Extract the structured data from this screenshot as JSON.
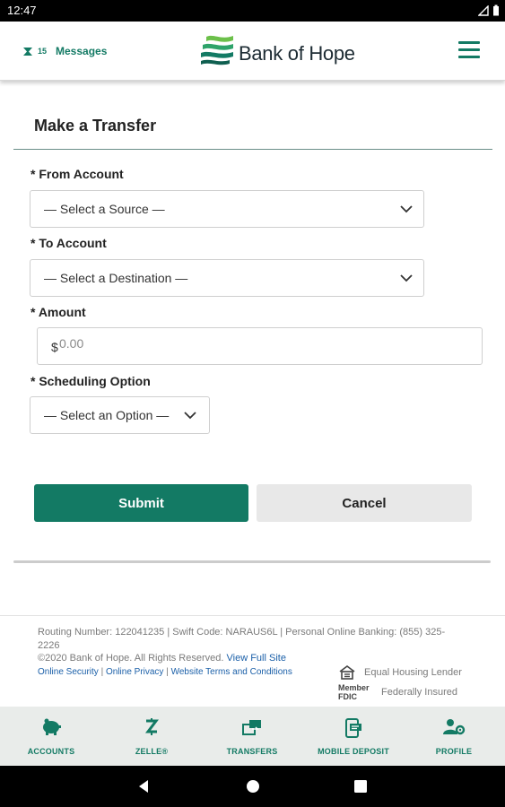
{
  "status_bar": {
    "time": "12:47"
  },
  "header": {
    "messages_count": "15",
    "messages_label": "Messages",
    "brand_name": "Bank of Hope",
    "colors": {
      "brand": "#137a64",
      "text": "#1d2b33"
    }
  },
  "form": {
    "title": "Make a Transfer",
    "from_label": "* From Account",
    "from_value": "— Select a Source —",
    "to_label": "* To Account",
    "to_value": "— Select a Destination —",
    "amount_label": "* Amount",
    "amount_currency": "$",
    "amount_placeholder": "0.00",
    "schedule_label": "* Scheduling Option",
    "schedule_value": "— Select an Option —",
    "submit_label": "Submit",
    "cancel_label": "Cancel"
  },
  "footer": {
    "info": "Routing Number: 122041235 | Swift Code: NARAUS6L | Personal Online Banking: (855) 325-2226",
    "copyright": "©2020 Bank of Hope. All Rights Reserved.",
    "view_full_site": "View Full Site",
    "links": [
      "Online Security",
      "Online Privacy",
      "Website Terms and Conditions"
    ],
    "equal_housing": "Equal Housing Lender",
    "fdic_badge": "Member FDIC",
    "federally_insured": "Federally Insured"
  },
  "tabs": [
    {
      "label": "ACCOUNTS",
      "icon": "piggy-bank-icon"
    },
    {
      "label": "ZELLE®",
      "icon": "zelle-icon"
    },
    {
      "label": "TRANSFERS",
      "icon": "transfer-icon"
    },
    {
      "label": "MOBILE DEPOSIT",
      "icon": "mobile-deposit-icon"
    },
    {
      "label": "PROFILE",
      "icon": "profile-settings-icon"
    }
  ]
}
